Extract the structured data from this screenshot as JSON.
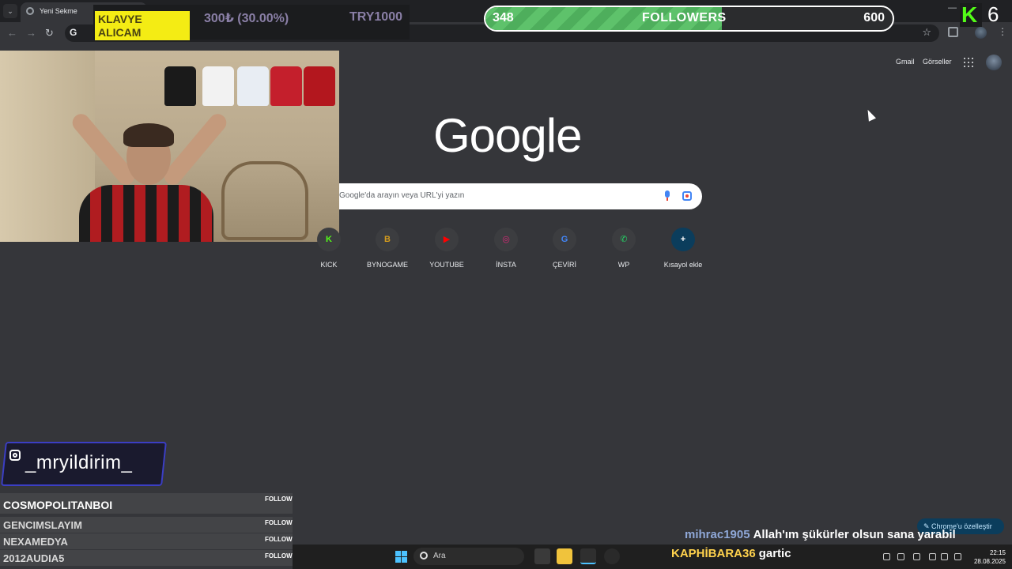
{
  "browser": {
    "tab_title": "Yeni Sekme",
    "omnibox_glyph": "G",
    "new_tab_glyph": "+",
    "close_glyph": "✕"
  },
  "overlay": {
    "goal_label": "KLAVYE ALICAM",
    "goal_progress": "300₺ (30.00%)",
    "goal_target": "TRY1000",
    "followers_count": "348",
    "followers_title": "FOLLOWERS",
    "followers_goal": "600",
    "followers_progress_fraction": 0.58,
    "kick_letter": "K",
    "kick_number": "6",
    "instagram_handle": "_mryildirim_"
  },
  "google": {
    "gmail": "Gmail",
    "images": "Görseller",
    "logo": "Google",
    "search_placeholder": "Google'da arayın veya URL'yi yazın",
    "customize": "✎  Chrome'u özelleştir",
    "shortcuts": [
      {
        "label": "KICK",
        "glyph": "K",
        "color": "#53fc18"
      },
      {
        "label": "BYNOGAME",
        "glyph": "B",
        "color": "#d29a1e"
      },
      {
        "label": "YOUTUBE",
        "glyph": "▶",
        "color": "#ff0000"
      },
      {
        "label": "İNSTA",
        "glyph": "◎",
        "color": "#d62976"
      },
      {
        "label": "ÇEVİRİ",
        "glyph": "G",
        "color": "#4285f4"
      },
      {
        "label": "WP",
        "glyph": "✆",
        "color": "#25d366"
      },
      {
        "label": "Kısayol ekle",
        "glyph": "+",
        "color": "#0b3d5c"
      }
    ]
  },
  "followers_list": {
    "follow_label": "FOLLOW",
    "names": [
      "COSMOPOLITANBOI",
      "GENCIMSLAYIM",
      "NEXAMEDYA",
      "2012AUDIA5"
    ]
  },
  "chat": [
    {
      "user": "mihrac1905",
      "message": "Allah'ım şükürler olsun sana yarabil"
    },
    {
      "user": "KAPHİBARA36",
      "message": "gartic"
    }
  ],
  "taskbar": {
    "search": "Ara",
    "time": "22:15",
    "date": "28.08.2025"
  },
  "colors": {
    "ntp_background": "#35363a",
    "goal_yellow": "#f4ec14",
    "followers_green": "#5ec26b",
    "kick_green": "#53fc18",
    "chat_user": "#8fa8d8"
  }
}
